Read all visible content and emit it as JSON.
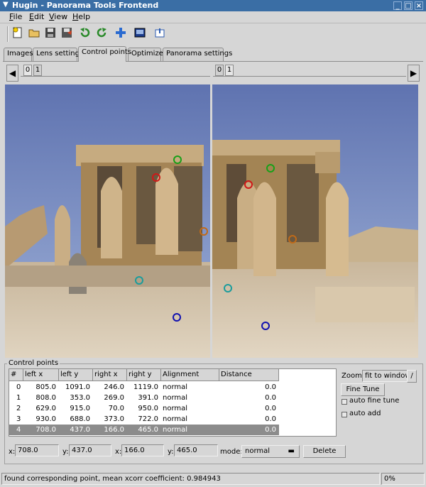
{
  "window": {
    "title": "Hugin - Panorama Tools Frontend"
  },
  "menu": [
    {
      "label": "File",
      "key": "F",
      "rest": "ile"
    },
    {
      "label": "Edit",
      "key": "E",
      "rest": "dit"
    },
    {
      "label": "View",
      "key": "V",
      "rest": "iew"
    },
    {
      "label": "Help",
      "key": "H",
      "rest": "elp"
    }
  ],
  "toolbar": {
    "icons": [
      "new-project-icon",
      "open-project-icon",
      "save-icon",
      "save-as-icon",
      "undo-icon",
      "redo-icon",
      "add-image-icon",
      "preview-icon",
      "about-icon"
    ]
  },
  "tabs": [
    {
      "label": "Images",
      "active": false
    },
    {
      "label": "Lens settings",
      "active": false
    },
    {
      "label": "Control points",
      "active": true
    },
    {
      "label": "Optimizer",
      "active": false
    },
    {
      "label": "Panorama settings",
      "active": false
    }
  ],
  "image_selector": {
    "left": {
      "tabs": [
        "0",
        "1"
      ],
      "selected": "0"
    },
    "right": {
      "tabs": [
        "0",
        "1"
      ],
      "selected": "1"
    }
  },
  "control_points": {
    "frame_title": "Control points",
    "columns": [
      "#",
      "left x",
      "left y",
      "right x",
      "right y",
      "Alignment",
      "Distance"
    ],
    "rows": [
      {
        "n": "0",
        "lx": "805.0",
        "ly": "1091.0",
        "rx": "246.0",
        "ry": "1119.0",
        "align": "normal",
        "dist": "0.0",
        "selected": false
      },
      {
        "n": "1",
        "lx": "808.0",
        "ly": "353.0",
        "rx": "269.0",
        "ry": "391.0",
        "align": "normal",
        "dist": "0.0",
        "selected": false
      },
      {
        "n": "2",
        "lx": "629.0",
        "ly": "915.0",
        "rx": "70.0",
        "ry": "950.0",
        "align": "normal",
        "dist": "0.0",
        "selected": false
      },
      {
        "n": "3",
        "lx": "930.0",
        "ly": "688.0",
        "rx": "373.0",
        "ry": "722.0",
        "align": "normal",
        "dist": "0.0",
        "selected": false
      },
      {
        "n": "4",
        "lx": "708.0",
        "ly": "437.0",
        "rx": "166.0",
        "ry": "465.0",
        "align": "normal",
        "dist": "0.0",
        "selected": true
      }
    ],
    "marker_colors": [
      "#1010b0",
      "#18a018",
      "#1a9c9c",
      "#c06a18",
      "#d01818"
    ]
  },
  "zoom": {
    "label": "Zoom:",
    "value": "fit to window"
  },
  "fine_tune": {
    "label": "Fine Tune"
  },
  "auto_fine_tune": {
    "label": "auto fine tune"
  },
  "auto_add": {
    "label": "auto add"
  },
  "edit_fields": {
    "x1_label": "x:",
    "x1": "708.0",
    "y1_label": "y:",
    "y1": "437.0",
    "x2_label": "x:",
    "x2": "166.0",
    "y2_label": "y:",
    "y2": "465.0",
    "mode_label": "mode:",
    "mode": "normal",
    "delete_label": "Delete"
  },
  "status": {
    "message": "found corresponding point, mean xcorr coefficient: 0.984943",
    "progress": "0%"
  }
}
